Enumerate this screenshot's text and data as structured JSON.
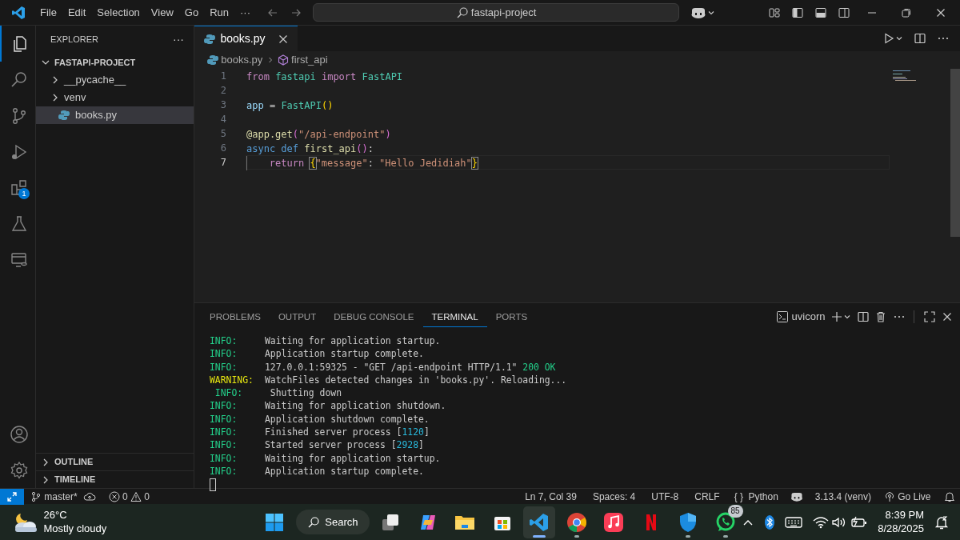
{
  "title_bar": {
    "menus": [
      "File",
      "Edit",
      "Selection",
      "View",
      "Go",
      "Run"
    ],
    "more": "···",
    "search": "fastapi-project"
  },
  "activity_bar": {
    "top": [
      {
        "kind": "explorer",
        "selected": true
      },
      {
        "kind": "search",
        "selected": false
      },
      {
        "kind": "source-control",
        "selected": false
      },
      {
        "kind": "run",
        "selected": false
      },
      {
        "kind": "extensions",
        "selected": false,
        "badge": "1"
      },
      {
        "kind": "testing",
        "selected": false
      },
      {
        "kind": "remote",
        "selected": false
      }
    ],
    "bottom": [
      {
        "kind": "account",
        "selected": false
      },
      {
        "kind": "settings",
        "selected": false
      }
    ]
  },
  "sidebar": {
    "title": "EXPLORER",
    "more": "···",
    "tree": [
      {
        "label": "FASTAPI-PROJECT",
        "kind": "root",
        "expanded": true,
        "selected": false,
        "children": [
          {
            "label": "__pycache__",
            "kind": "folder",
            "expanded": false,
            "selected": false
          },
          {
            "label": "venv",
            "kind": "folder",
            "expanded": false,
            "selected": false
          },
          {
            "label": "books.py",
            "kind": "python",
            "selected": true
          }
        ]
      }
    ],
    "sections": [
      {
        "label": "OUTLINE",
        "expanded": false
      },
      {
        "label": "TIMELINE",
        "expanded": false
      }
    ]
  },
  "editor": {
    "tabs": [
      {
        "label": "books.py",
        "selected": true
      }
    ],
    "breadcrumbs": [
      {
        "label": "books.py",
        "kind": "python"
      },
      {
        "label": "first_api",
        "kind": "function"
      }
    ],
    "lines": [
      {
        "number": "1",
        "current": false,
        "tokens": [
          {
            "text": "from",
            "kind": "keyword"
          },
          {
            "text": " fastapi",
            "kind": "module"
          },
          {
            "text": " import",
            "kind": "keyword"
          },
          {
            "text": " FastAPI",
            "kind": "class"
          }
        ]
      },
      {
        "number": "2",
        "current": false
      },
      {
        "number": "3",
        "current": false,
        "tokens": [
          {
            "text": "app",
            "kind": "variable"
          },
          {
            "text": " = ",
            "kind": "plain"
          },
          {
            "text": "FastAPI",
            "kind": "class"
          },
          {
            "text": "()",
            "kind": "bracket"
          }
        ]
      },
      {
        "number": "4",
        "current": false
      },
      {
        "number": "5",
        "current": false,
        "tokens": [
          {
            "text": "@app.get",
            "kind": "function"
          },
          {
            "text": "(",
            "kind": "bracket2"
          },
          {
            "text": "\"/api-endpoint\"",
            "kind": "string"
          },
          {
            "text": ")",
            "kind": "bracket2"
          }
        ]
      },
      {
        "number": "6",
        "current": false,
        "tokens": [
          {
            "text": "async def",
            "kind": "storage"
          },
          {
            "text": " first_api",
            "kind": "function"
          },
          {
            "text": "()",
            "kind": "bracket2"
          },
          {
            "text": ":",
            "kind": "plain"
          }
        ]
      },
      {
        "number": "7",
        "current": true,
        "indented": true,
        "tokens": [
          {
            "text": "return ",
            "kind": "keyword"
          },
          {
            "text": "{",
            "kind": "bracket-match"
          },
          {
            "text": "\"message\"",
            "kind": "string"
          },
          {
            "text": ": ",
            "kind": "plain"
          },
          {
            "text": "\"Hello Jedidiah\"",
            "kind": "string"
          },
          {
            "text": "}",
            "kind": "bracket-match"
          }
        ]
      }
    ]
  },
  "panel": {
    "tabs": [
      {
        "label": "PROBLEMS",
        "selected": false
      },
      {
        "label": "OUTPUT",
        "selected": false
      },
      {
        "label": "DEBUG CONSOLE",
        "selected": false
      },
      {
        "label": "TERMINAL",
        "selected": true
      },
      {
        "label": "PORTS",
        "selected": false
      }
    ],
    "terminal_name": "uvicorn",
    "lines": [
      {
        "level": "INFO:",
        "kind": "info",
        "message": [
          {
            "text": "Waiting for application startup.",
            "kind": "plain"
          }
        ]
      },
      {
        "level": "INFO:",
        "kind": "info",
        "message": [
          {
            "text": "Application startup complete.",
            "kind": "plain"
          }
        ]
      },
      {
        "level": "INFO:",
        "kind": "info",
        "message": [
          {
            "text": "127.0.0.1:59325 - \"GET /api-endpoint HTTP/1.1\" ",
            "kind": "plain"
          },
          {
            "text": "200 OK",
            "kind": "ok"
          }
        ]
      },
      {
        "level": "WARNING:",
        "kind": "warning",
        "message": [
          {
            "text": "WatchFiles detected changes in 'books.py'. Reloading...",
            "kind": "plain"
          }
        ]
      },
      {
        "level": " INFO:",
        "kind": "info",
        "message": [
          {
            "text": " Shutting down",
            "kind": "plain"
          }
        ]
      },
      {
        "level": "INFO:",
        "kind": "info",
        "message": [
          {
            "text": "Waiting for application shutdown.",
            "kind": "plain"
          }
        ]
      },
      {
        "level": "INFO:",
        "kind": "info",
        "message": [
          {
            "text": "Application shutdown complete.",
            "kind": "plain"
          }
        ]
      },
      {
        "level": "INFO:",
        "kind": "info",
        "message": [
          {
            "text": "Finished server process [",
            "kind": "plain"
          },
          {
            "text": "1120",
            "kind": "number"
          },
          {
            "text": "]",
            "kind": "plain"
          }
        ]
      },
      {
        "level": "INFO:",
        "kind": "info",
        "message": [
          {
            "text": "Started server process [",
            "kind": "plain"
          },
          {
            "text": "2928",
            "kind": "number"
          },
          {
            "text": "]",
            "kind": "plain"
          }
        ]
      },
      {
        "level": "INFO:",
        "kind": "info",
        "message": [
          {
            "text": "Waiting for application startup.",
            "kind": "plain"
          }
        ]
      },
      {
        "level": "INFO:",
        "kind": "info",
        "message": [
          {
            "text": "Application startup complete.",
            "kind": "plain"
          }
        ]
      }
    ]
  },
  "status_bar": {
    "branch": "master*",
    "errors": "0",
    "warnings": "0",
    "position": "Ln 7, Col 39",
    "indent": "Spaces: 4",
    "encoding": "UTF-8",
    "eol": "CRLF",
    "language_icon": "{ }",
    "language": "Python",
    "interpreter": "3.13.4 (venv)",
    "live": "Go Live"
  },
  "taskbar": {
    "weather": {
      "temperature": "26°C",
      "condition": "Mostly cloudy"
    },
    "search": "Search",
    "apps": [
      {
        "kind": "task-view",
        "selected": false,
        "running": false
      },
      {
        "kind": "copilot",
        "selected": false,
        "running": false
      },
      {
        "kind": "files",
        "selected": false,
        "running": false
      },
      {
        "kind": "store",
        "selected": false,
        "running": false
      },
      {
        "kind": "vscode",
        "selected": true,
        "running": true
      },
      {
        "kind": "chrome",
        "selected": false,
        "running": true
      },
      {
        "kind": "music",
        "selected": false,
        "running": false
      },
      {
        "kind": "netflix",
        "selected": false,
        "running": false
      },
      {
        "kind": "defender",
        "selected": false,
        "running": true
      },
      {
        "kind": "whatsapp",
        "selected": false,
        "running": true,
        "badge": "85"
      }
    ],
    "time": "8:39 PM",
    "date": "8/28/2025"
  }
}
